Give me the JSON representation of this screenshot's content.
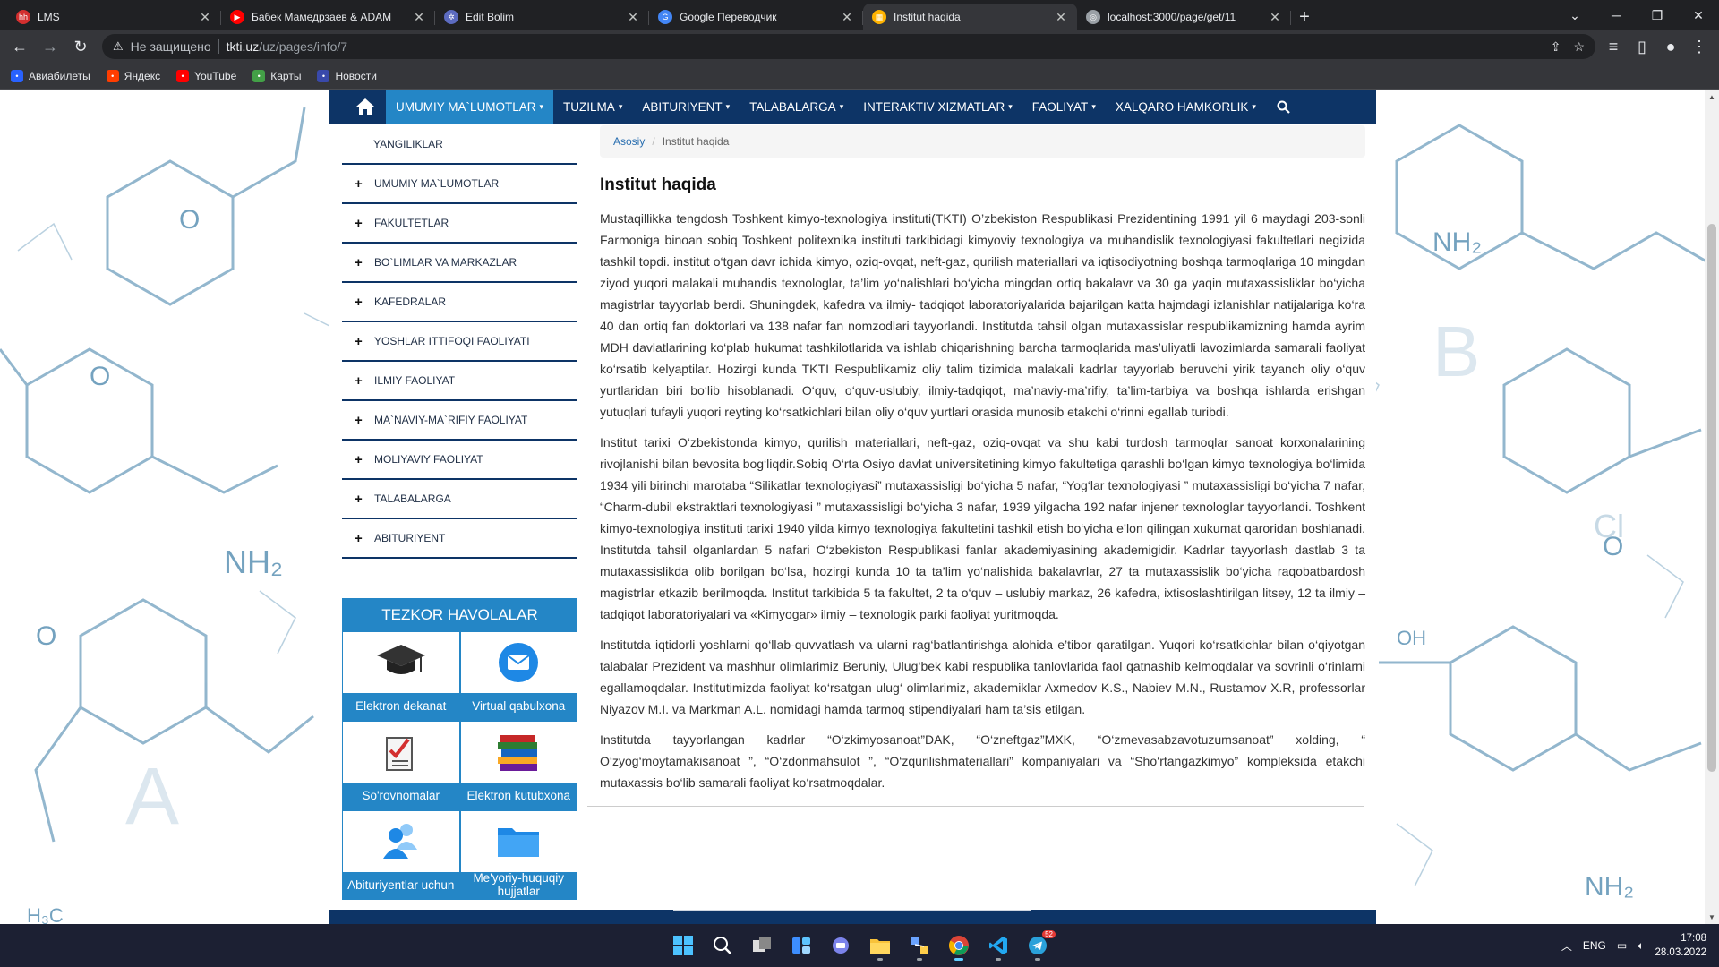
{
  "browser": {
    "tabs": [
      {
        "title": "LMS",
        "favicon": "hh",
        "favcolor": "#d32f2f"
      },
      {
        "title": "Бабек Мамедрзаев & ADAM",
        "favicon": "▶",
        "favcolor": "#ff0000"
      },
      {
        "title": "Edit Bolim",
        "favicon": "✲",
        "favcolor": "#5c6bc0"
      },
      {
        "title": "Google Переводчик",
        "favicon": "G",
        "favcolor": "#4285f4"
      },
      {
        "title": "Institut haqida",
        "favicon": "▦",
        "favcolor": "#ffb300",
        "active": true
      },
      {
        "title": "localhost:3000/page/get/11",
        "favicon": "◎",
        "favcolor": "#9aa0a6"
      }
    ],
    "new_tab": "+",
    "address": {
      "insecure_label": "Не защищено",
      "host": "tkti.uz",
      "path": "/uz/pages/info/7"
    },
    "bookmarks": [
      {
        "label": "Авиабилеты",
        "icon": "plane-icon",
        "color": "#2962ff"
      },
      {
        "label": "Яндекс",
        "icon": "yandex-icon",
        "color": "#ff3d00"
      },
      {
        "label": "YouTube",
        "icon": "youtube-icon",
        "color": "#ff0000"
      },
      {
        "label": "Карты",
        "icon": "maps-icon",
        "color": "#43a047"
      },
      {
        "label": "Новости",
        "icon": "news-icon",
        "color": "#3949ab"
      }
    ]
  },
  "site": {
    "colors": {
      "navy": "#0d3466",
      "accent": "#2486c6"
    },
    "nav": [
      {
        "label": "UMUMIY MA`LUMOTLAR",
        "active": true
      },
      {
        "label": "TUZILMA"
      },
      {
        "label": "ABITURIYENT"
      },
      {
        "label": "TALABALARGA"
      },
      {
        "label": "INTERAKTIV XIZMATLAR"
      },
      {
        "label": "FAOLIYAT"
      },
      {
        "label": "XALQARO HAMKORLIK"
      }
    ],
    "sidebar": [
      {
        "label": "YANGILIKLAR",
        "plus": false
      },
      {
        "label": "UMUMIY MA`LUMOTLAR",
        "plus": true
      },
      {
        "label": "FAKULTETLAR",
        "plus": true
      },
      {
        "label": "BO`LIMLAR VA MARKAZLAR",
        "plus": true
      },
      {
        "label": "KAFEDRALAR",
        "plus": true
      },
      {
        "label": "YOSHLAR ITTIFOQI FAOLIYATI",
        "plus": true
      },
      {
        "label": "ILMIY FAOLIYAT",
        "plus": true
      },
      {
        "label": "MA`NAVIY-MA`RIFIY FAOLIYAT",
        "plus": true
      },
      {
        "label": "MOLIYAVIY FAOLIYAT",
        "plus": true
      },
      {
        "label": "TALABALARGA",
        "plus": true
      },
      {
        "label": "ABITURIYENT",
        "plus": true
      }
    ],
    "quick_links": {
      "title": "TEZKOR HAVOLALAR",
      "items": [
        {
          "label": "Elektron dekanat",
          "icon": "graduation-cap-icon"
        },
        {
          "label": "Virtual qabulxona",
          "icon": "mail-icon"
        },
        {
          "label": "So'rovnomalar",
          "icon": "checklist-icon"
        },
        {
          "label": "Elektron kutubxona",
          "icon": "books-icon"
        },
        {
          "label": "Abituriyentlar uchun",
          "icon": "people-icon"
        },
        {
          "label": "Me'yoriy-huquqiy hujjatlar",
          "icon": "folder-icon"
        }
      ]
    },
    "breadcrumb": {
      "home": "Asosiy",
      "separator": "/",
      "current": "Institut haqida"
    },
    "article": {
      "title": "Institut haqida",
      "paragraphs": [
        "Mustaqillikka tengdosh Toshkent kimyo-texnologiya instituti(TKTI) O’zbekiston Respublikasi Prezidentining 1991 yil 6 maydagi 203-sonli Farmoniga binoan sobiq Toshkent politexnika instituti tarkibidagi kimyoviy texnologiya va muhandislik texnologiyasi fakultetlari negizida tashkil topdi. institut o‘tgan davr ichida kimyo, oziq-ovqat, neft-gaz, qurilish materiallari va iqtisodiyotning boshqa tarmoqlariga 10 mingdan ziyod yuqori malakali muhandis texnologlar, ta’lim yo‘nalishlari bo‘yicha mingdan ortiq bakalavr va 30 ga yaqin mutaxassisliklar bo‘yicha magistrlar tayyorlab berdi. Shuningdek, kafedra va ilmiy- tadqiqot laboratoriyalarida bajarilgan katta hajmdagi izlanishlar natijalariga ko‘ra 40 dan ortiq fan doktorlari va 138 nafar fan nomzodlari tayyorlandi. Institutda tahsil olgan mutaxassislar respublikamizning hamda ayrim MDH davlatlarining ko‘plab hukumat tashkilotlarida va ishlab chiqarishning barcha tarmoqlarida mas’uliyatli lavozimlarda samarali faoliyat ko‘rsatib kelyaptilar. Hozirgi kunda TKTI Respublikamiz oliy talim tizimida malakali kadrlar tayyorlab beruvchi yirik tayanch oliy o‘quv yurtlaridan biri bo‘lib hisoblanadi. O‘quv, o‘quv-uslubiy, ilmiy-tadqiqot, ma’naviy-ma’rifiy, ta’lim-tarbiya va boshqa ishlarda erishgan yutuqlari tufayli yuqori reyting ko‘rsatkichlari bilan oliy o‘quv yurtlari orasida munosib etakchi o‘rinni egallab turibdi.",
        "Institut tarixi O‘zbekistonda kimyo, qurilish materiallari, neft-gaz, oziq-ovqat va shu kabi turdosh tarmoqlar sanoat korxonalarining rivojlanishi bilan bevosita bog‘liqdir.Sobiq O‘rta Osiyo davlat universitetining kimyo fakultetiga qarashli bo‘lgan kimyo texnologiya bo‘limida 1934 yili birinchi marotaba “Silikatlar texnologiyasi” mutaxassisligi bo‘yicha 5 nafar, “Yog‘lar texnologiyasi ” mutaxassisligi bo‘yicha 7 nafar, “Charm-dubil ekstraktlari texnologiyasi ” mutaxassisligi bo‘yicha 3 nafar, 1939 yilgacha 192 nafar injener texnologlar tayyorlandi. Toshkent kimyo-texnologiya instituti tarixi 1940 yilda kimyo texnologiya fakultetini tashkil etish bo‘yicha e’lon qilingan xukumat qaroridan boshlanadi. Institutda tahsil olganlardan 5 nafari O‘zbekiston Respublikasi fanlar akademiyasining akademigidir. Kadrlar tayyorlash dastlab 3 ta mutaxassislikda olib borilgan bo‘lsa, hozirgi kunda 10 ta ta’lim yo‘nalishida bakalavrlar, 27 ta mutaxassislik bo‘yicha raqobatbardosh magistrlar etkazib berilmoqda. Institut tarkibida 5 ta fakultet, 2 ta o‘quv – uslubiy markaz, 26 kafedra, ixtisoslashtirilgan litsey, 12 ta ilmiy – tadqiqot laboratoriyalari va «Kimyogar» ilmiy – texnologik parki faoliyat yuritmoqda.",
        "Institutda iqtidorli yoshlarni qo‘llab-quvvatlash va ularni rag‘batlantirishga alohida e’tibor qaratilgan. Yuqori ko‘rsatkichlar bilan o‘qiyotgan talabalar Prezident va mashhur olimlarimiz Beruniy, Ulug‘bek kabi respublika tanlovlarida faol qatnashib kelmoqdalar va sovrinli o‘rinlarni egallamoqdalar. Institutimizda faoliyat ko‘rsatgan ulug‘ olimlarimiz, akademiklar Axmedov K.S., Nabiev M.N., Rustamov X.R, professorlar Niyazov M.I. va Markman A.L. nomidagi hamda tarmoq stipendiyalari ham ta’sis etilgan.",
        "Institutda tayyorlangan kadrlar “O‘zkimyosanoat”DAK, “O‘zneftgaz”MXK, “O‘zmevasabzavotuzumsanoat” xolding, “ O‘zyog‘moytamakisanoat ”, “O‘zdonmahsulot ”, “O‘zqurilishmateriallari” kompaniyalari va “Sho‘rtangazkimyo” kompleksida etakchi mutaxassis bo‘lib samarali faoliyat ko‘rsatmoqdalar."
      ]
    }
  },
  "taskbar": {
    "apps": [
      "start-icon",
      "search-icon",
      "task-view-icon",
      "widgets-icon",
      "teams-chat-icon",
      "file-explorer-icon",
      "network-app-icon",
      "chrome-icon",
      "vscode-icon",
      "telegram-icon"
    ],
    "telegram_badge": "52",
    "lang": "ENG",
    "time": "17:08",
    "date": "28.03.2022"
  }
}
